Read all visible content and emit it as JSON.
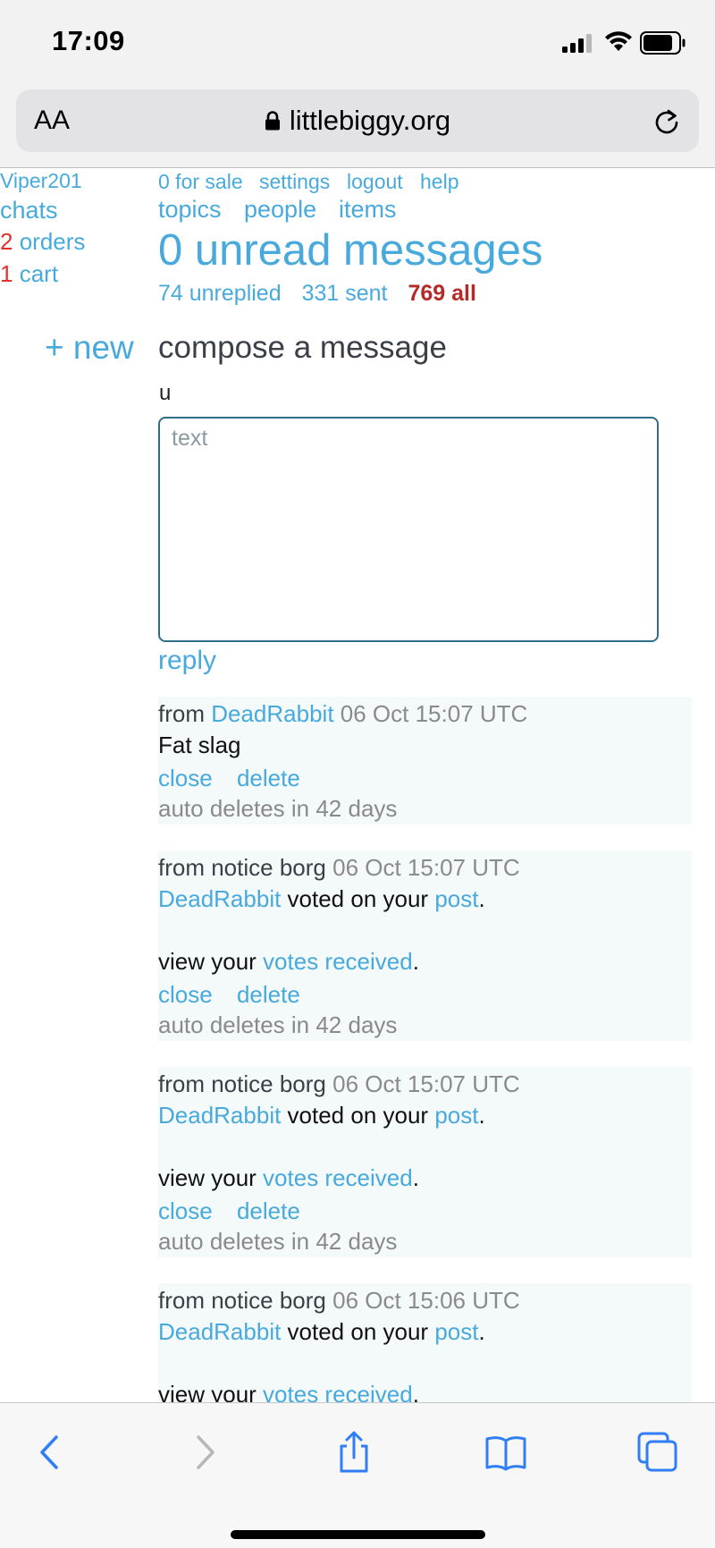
{
  "status_bar": {
    "time": "17:09"
  },
  "browser": {
    "text_size_label": "AA",
    "url": "littlebiggy.org",
    "reload_icon": "reload-icon",
    "lock_icon": "lock-icon"
  },
  "sidebar": {
    "username": "Viper201",
    "chats": "chats",
    "orders_count": "2",
    "orders_label": "orders",
    "cart_count": "1",
    "cart_label": "cart"
  },
  "nav": {
    "for_sale": "0 for sale",
    "settings": "settings",
    "logout": "logout",
    "help": "help",
    "topics": "topics",
    "people": "people",
    "items": "items"
  },
  "inbox": {
    "unread_title": "0 unread messages",
    "unreplied": "74 unreplied",
    "sent": "331 sent",
    "all": "769 all"
  },
  "compose": {
    "new_label": "+ new",
    "title": "compose a message",
    "recipient": "u",
    "text_placeholder": "text",
    "reply_label": "reply"
  },
  "messages": [
    {
      "from_prefix": "from",
      "from_name": "DeadRabbit",
      "time": "06 Oct 15:07 UTC",
      "body": "Fat slag",
      "close": "close",
      "delete": "delete",
      "auto_delete": "auto deletes in 42 days"
    },
    {
      "from": "from notice borg",
      "time": "06 Oct 15:07 UTC",
      "user": "DeadRabbit",
      "voted_text": " voted on your ",
      "post_link": "post",
      "view_text": "view your ",
      "votes_link": "votes received",
      "close": "close",
      "delete": "delete",
      "auto_delete": "auto deletes in 42 days"
    },
    {
      "from": "from notice borg",
      "time": "06 Oct 15:07 UTC",
      "user": "DeadRabbit",
      "voted_text": " voted on your ",
      "post_link": "post",
      "view_text": "view your ",
      "votes_link": "votes received",
      "close": "close",
      "delete": "delete",
      "auto_delete": "auto deletes in 42 days"
    },
    {
      "from": "from notice borg",
      "time": "06 Oct 15:06 UTC",
      "user": "DeadRabbit",
      "voted_text": " voted on your ",
      "post_link": "post",
      "view_text": "view your ",
      "votes_link": "votes received"
    }
  ],
  "toolbar": {
    "back_icon": "back-icon",
    "forward_icon": "forward-icon",
    "share_icon": "share-icon",
    "bookmarks_icon": "bookmarks-icon",
    "tabs_icon": "tabs-icon"
  },
  "colors": {
    "link": "#48aadc",
    "count_red": "#e0322e",
    "all_red": "#b52a28",
    "message_bg": "#f4f9fa",
    "textarea_border": "#2f6f85"
  }
}
